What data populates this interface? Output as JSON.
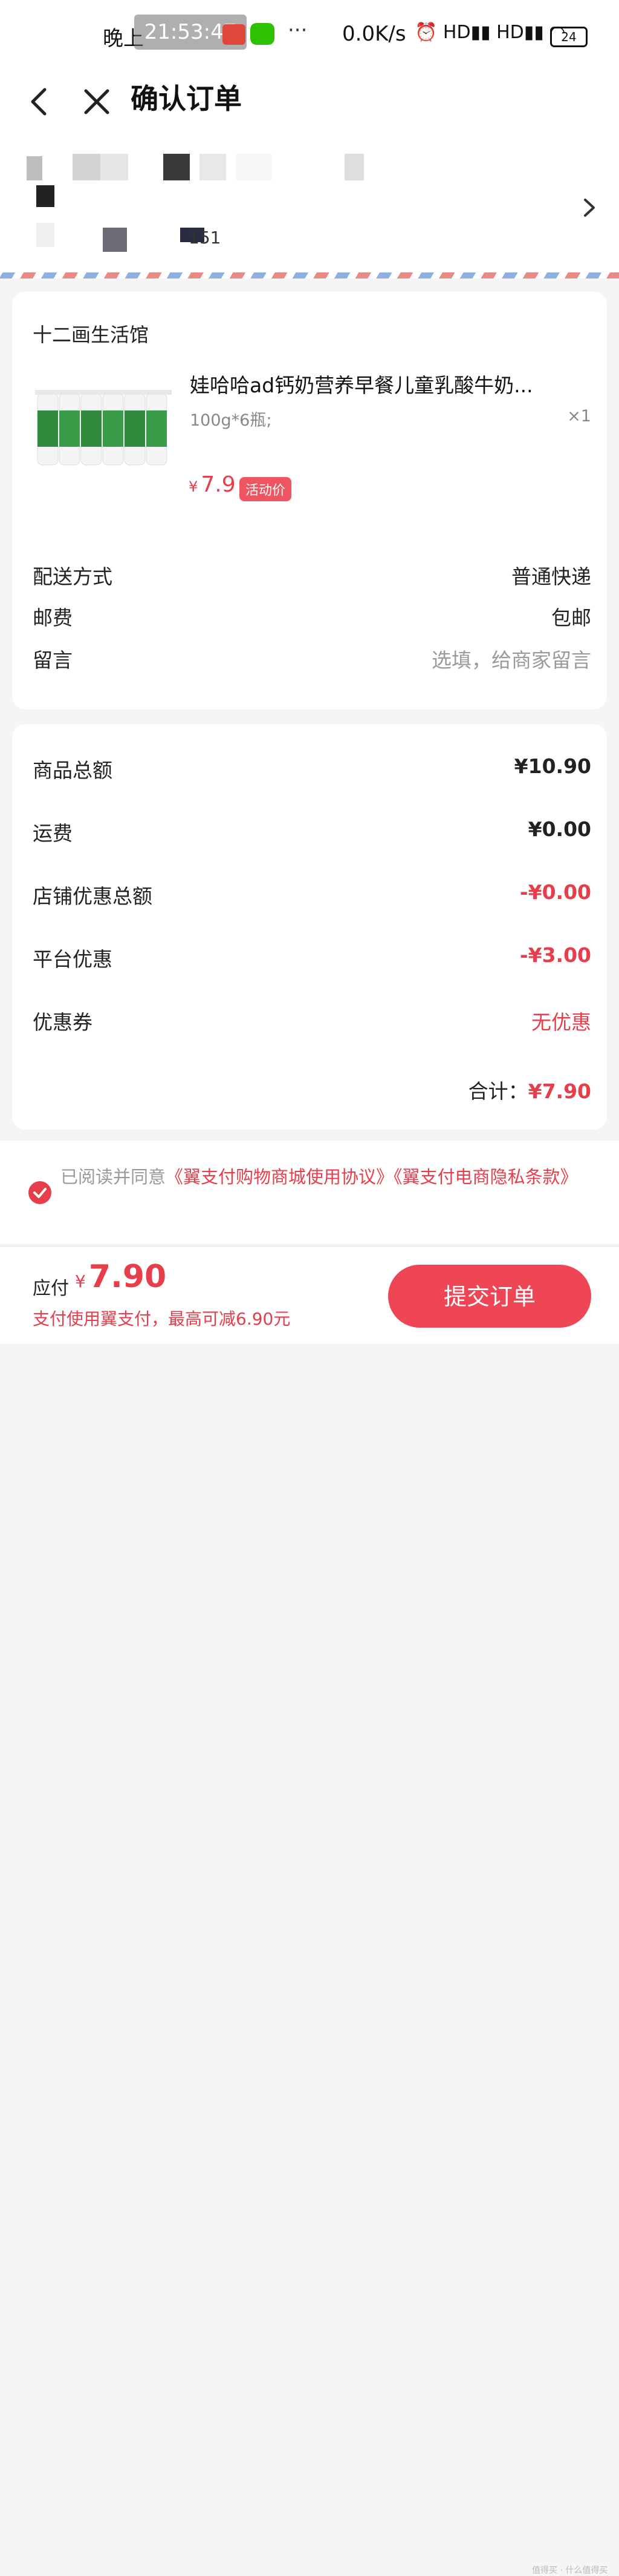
{
  "status_bar": {
    "time": "晚上",
    "overlay_time": "21:53:47",
    "more": "···",
    "net_speed": "0.0K/s",
    "signal_icons": "⏰ HD▮▮ HD▮▮ ◠",
    "battery": "24"
  },
  "nav": {
    "title": "确认订单"
  },
  "address": {
    "suffix": "151"
  },
  "shop": {
    "name": "十二画生活馆",
    "product": {
      "title": "娃哈哈ad钙奶营养早餐儿童乳酸牛奶...",
      "spec": "100g*6瓶;",
      "qty": "×1",
      "price_symbol": "¥",
      "price": "7.9",
      "tag": "活动价"
    },
    "rows": [
      {
        "label": "配送方式",
        "value": "普通快递"
      },
      {
        "label": "邮费",
        "value": "包邮"
      },
      {
        "label": "留言",
        "value": "选填，给商家留言"
      }
    ]
  },
  "totals": {
    "rows": [
      {
        "label": "商品总额",
        "value": "¥10.90"
      },
      {
        "label": "运费",
        "value": "¥0.00"
      },
      {
        "label": "店铺优惠总额",
        "value": "-¥0.00"
      },
      {
        "label": "平台优惠",
        "value": "-¥3.00"
      },
      {
        "label": "优惠券",
        "value": "无优惠"
      }
    ],
    "sum_label": "合计：",
    "sum_value": "¥7.90"
  },
  "agreement": {
    "prefix": "已阅读并同意",
    "link1": "《翼支付购物商城使用协议》",
    "link2": "《翼支付电商隐私条款》"
  },
  "bottom": {
    "pay_label": "应付",
    "pay_symbol": "¥",
    "pay_amount": "7.90",
    "pay_note": "支付使用翼支付，最高可减6.90元",
    "submit": "提交订单"
  },
  "colors": {
    "accent": "#e63e4a",
    "button": "#ef4655"
  },
  "watermark": "值得买 · 什么值得买"
}
